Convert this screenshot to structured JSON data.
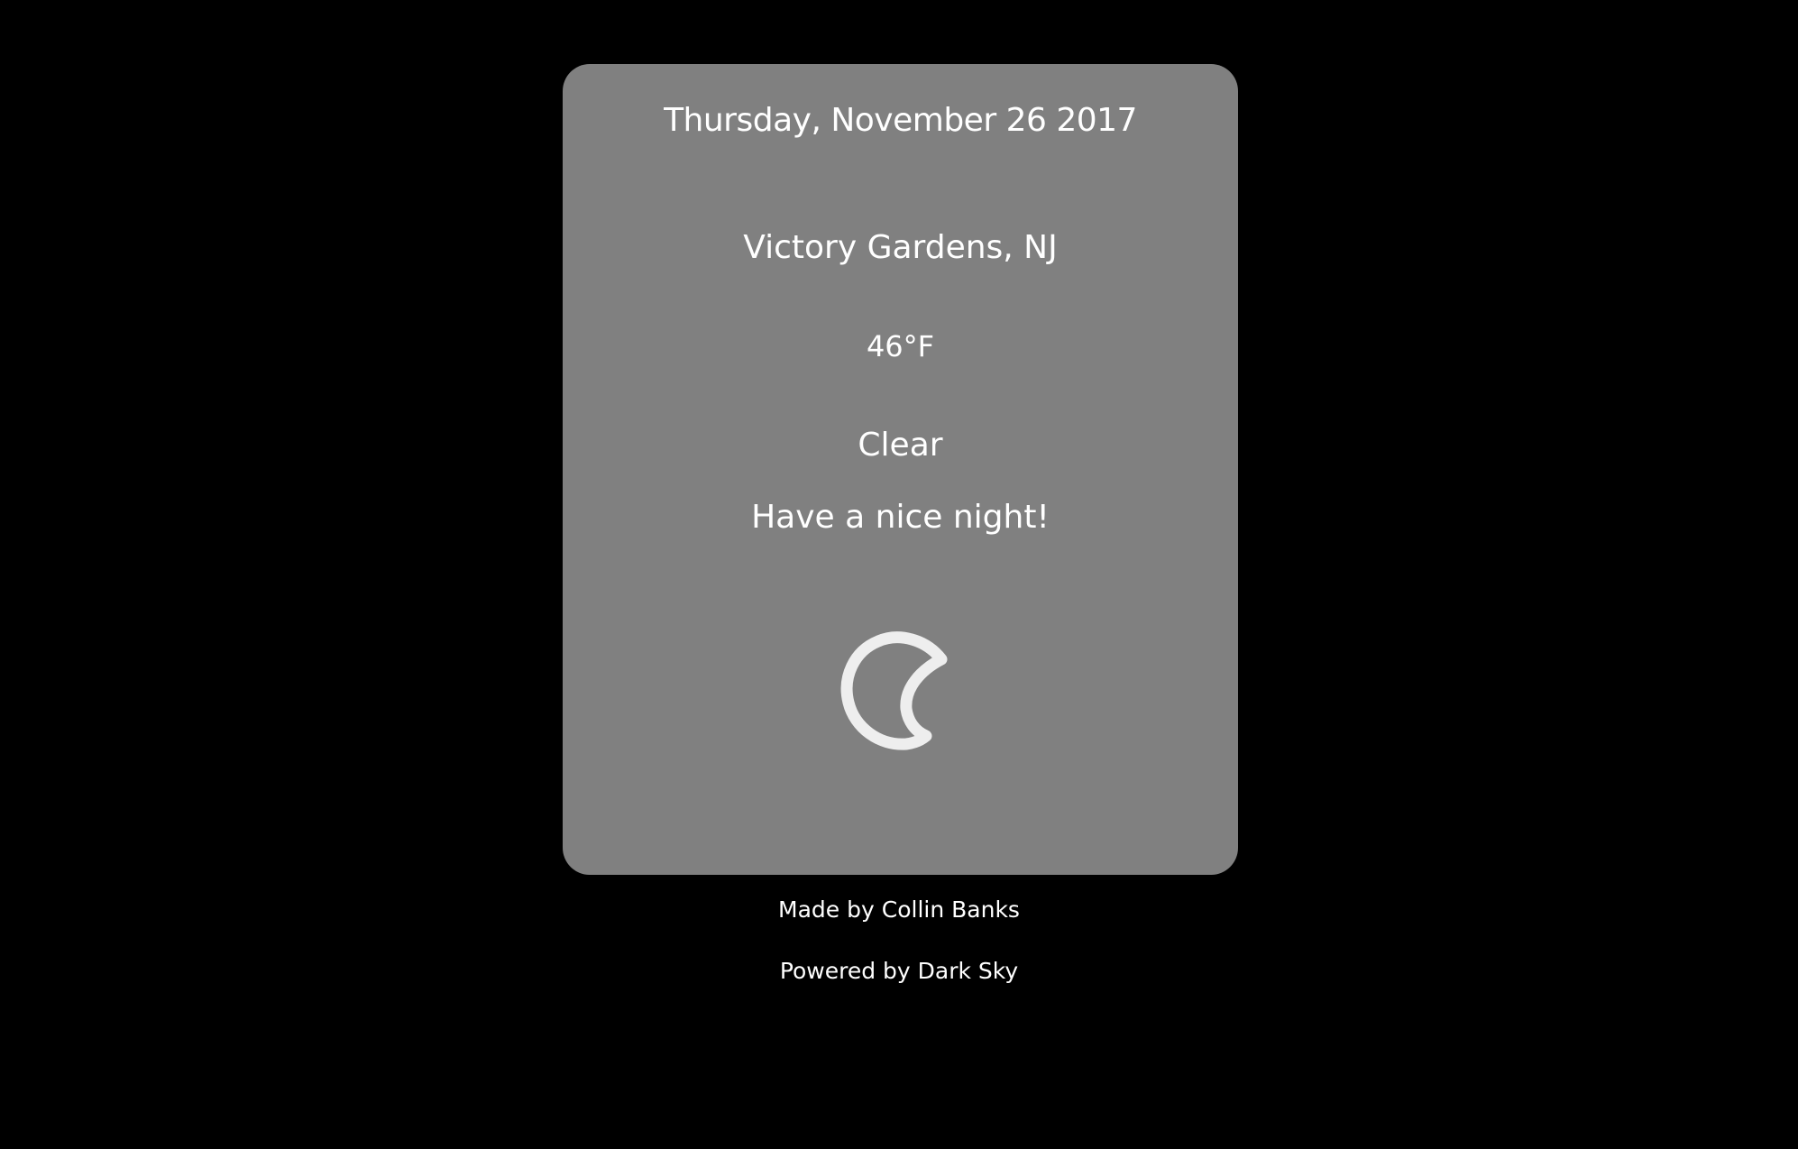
{
  "colors": {
    "page_background": "#000000",
    "card_background": "#808080",
    "text": "#ffffff",
    "icon_stroke": "#eeeeee"
  },
  "weather": {
    "date": "Thursday, November 26 2017",
    "location": "Victory Gardens, NJ",
    "temperature": "46°F",
    "summary": "Clear",
    "greeting": "Have a nice night!",
    "icon": "clear-night-moon-icon"
  },
  "footer": {
    "credit": "Made by Collin Banks",
    "powered_by": "Powered by Dark Sky"
  }
}
